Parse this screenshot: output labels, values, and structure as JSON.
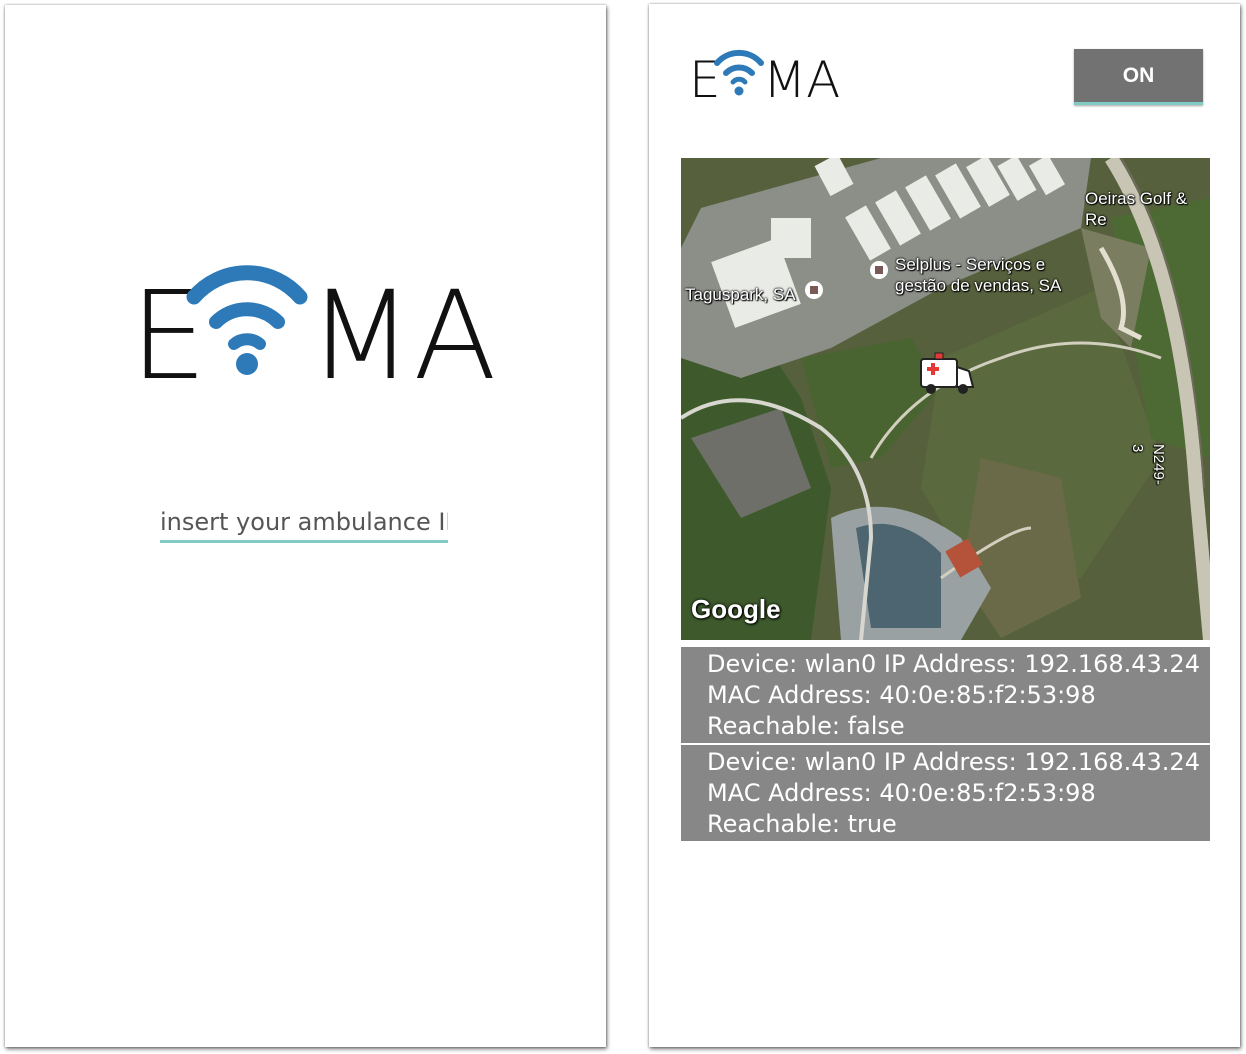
{
  "login_screen": {
    "logo": {
      "left_letter": "E",
      "right_letters": "MA",
      "wifi_color": "#2e7ab8"
    },
    "ambulance_id": {
      "placeholder": "insert your ambulance ID",
      "value": ""
    }
  },
  "map_screen": {
    "logo": {
      "left_letter": "E",
      "right_letters": "MA",
      "wifi_color": "#2e7ab8"
    },
    "toggle_button": {
      "label": "ON"
    },
    "map": {
      "labels": {
        "golf": "Oeiras Golf & Re",
        "selplus": "Selplus - Serviços e\ngestão de vendas, SA",
        "taguspark": "Taguspark, SA",
        "road": "N249-3"
      },
      "attribution": "Google",
      "marker_icon": "ambulance-icon"
    },
    "devices": [
      {
        "line1": "Device: wlan0 IP Address: 192.168.43.24",
        "line2": "MAC Address: 40:0e:85:f2:53:98",
        "line3": "Reachable: false"
      },
      {
        "line1": "Device: wlan0 IP Address: 192.168.43.24",
        "line2": "MAC Address: 40:0e:85:f2:53:98",
        "line3": "Reachable: true"
      }
    ]
  }
}
